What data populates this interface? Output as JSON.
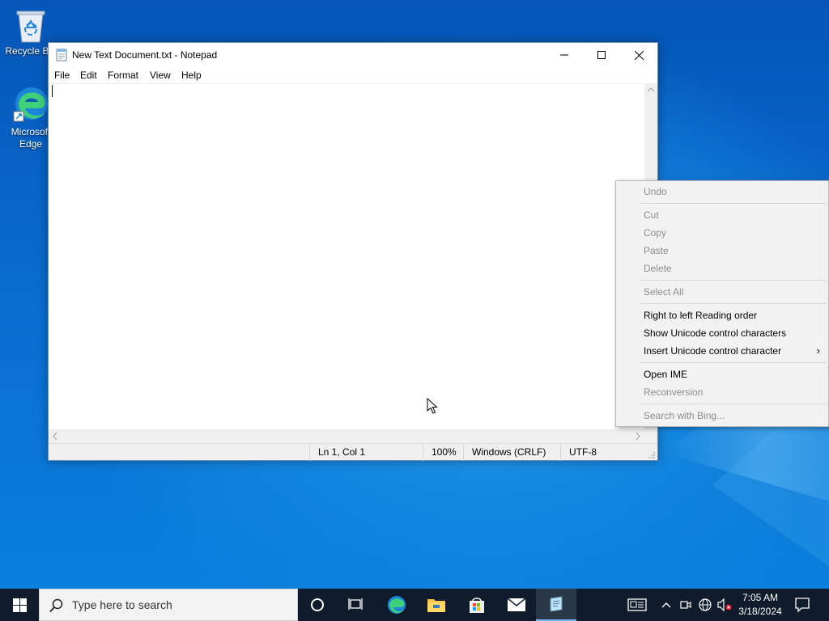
{
  "desktop": {
    "icons": [
      {
        "name": "recycle-bin",
        "label": "Recycle Bin"
      },
      {
        "name": "microsoft-edge",
        "label": "Microsoft Edge"
      }
    ]
  },
  "notepad": {
    "title": "New Text Document.txt - Notepad",
    "menu": [
      "File",
      "Edit",
      "Format",
      "View",
      "Help"
    ],
    "content": "",
    "status": {
      "position": "Ln 1, Col 1",
      "zoom": "100%",
      "line_ending": "Windows (CRLF)",
      "encoding": "UTF-8"
    }
  },
  "context_menu": {
    "items": [
      {
        "label": "Undo",
        "enabled": false
      },
      {
        "label": "Cut",
        "enabled": false
      },
      {
        "label": "Copy",
        "enabled": false
      },
      {
        "label": "Paste",
        "enabled": false
      },
      {
        "label": "Delete",
        "enabled": false
      },
      {
        "label": "Select All",
        "enabled": false
      },
      {
        "label": "Right to left Reading order",
        "enabled": true
      },
      {
        "label": "Show Unicode control characters",
        "enabled": true
      },
      {
        "label": "Insert Unicode control character",
        "enabled": true,
        "submenu": true
      },
      {
        "label": "Open IME",
        "enabled": true
      },
      {
        "label": "Reconversion",
        "enabled": false
      },
      {
        "label": "Search with Bing...",
        "enabled": false
      }
    ]
  },
  "taskbar": {
    "search_placeholder": "Type here to search",
    "apps": [
      "cortana",
      "task-view",
      "edge",
      "file-explorer",
      "microsoft-store",
      "mail",
      "notepad"
    ],
    "clock": {
      "time": "7:05 AM",
      "date": "3/18/2024"
    }
  },
  "colors": {
    "taskbar": "#101c2c",
    "desktop_blue": "#0a6fd0",
    "disabled_text": "#8d8d8d"
  }
}
